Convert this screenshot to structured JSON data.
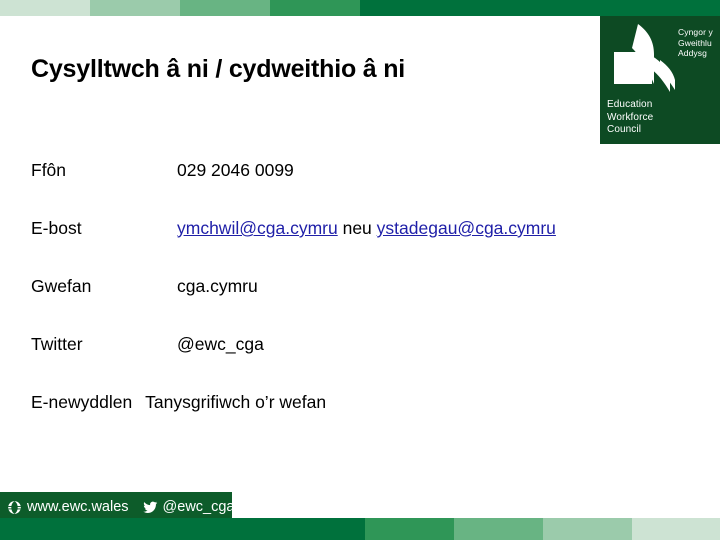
{
  "slide": {
    "title": "Cysylltwch â ni / cydweithio â ni"
  },
  "brand": {
    "accent_dark": "#00713c",
    "logo_panel": "#0d4a23",
    "footer_bar": "#0d5c2a",
    "link_color": "#1f1fa8",
    "stripe_top": [
      "#cde3d3",
      "#9bcbab",
      "#68b483",
      "#2f9657",
      "#00713c"
    ],
    "stripe_bottom": [
      "#00713c",
      "#2f9657",
      "#68b483",
      "#9bcbab",
      "#cde3d3"
    ]
  },
  "logo": {
    "welsh_lines": [
      "Cyngor y",
      "Gweithlu",
      "Addysg"
    ],
    "english_lines": [
      "Education",
      "Workforce",
      "Council"
    ],
    "mark_name": "ewc-book-pages-mark"
  },
  "contacts": [
    {
      "label": "Ffôn",
      "value": "029 2046 0099",
      "kind": "text",
      "name": "phone"
    },
    {
      "label": "E-bost",
      "kind": "emails",
      "name": "email",
      "email_primary": "ymchwil@cga.cymru",
      "separator": "neu",
      "email_secondary": "ystadegau@cga.cymru"
    },
    {
      "label": "Gwefan",
      "value": "cga.cymru",
      "kind": "text",
      "name": "website"
    },
    {
      "label": "Twitter",
      "value": "@ewc_cga",
      "kind": "text",
      "name": "twitter"
    },
    {
      "label": "E-newyddlen",
      "value": "Tanysgrifiwch o’r wefan",
      "kind": "text-wide",
      "name": "newsletter"
    }
  ],
  "footer": {
    "website": "www.ewc.wales",
    "twitter": "@ewc_cga",
    "globe_icon": "globe-icon",
    "twitter_icon": "twitter-bird-icon"
  }
}
